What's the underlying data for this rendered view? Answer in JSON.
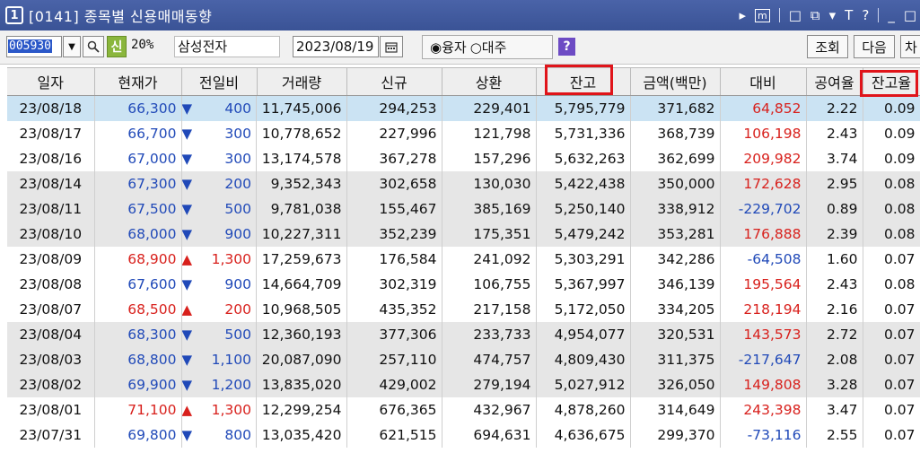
{
  "window": {
    "number": "1",
    "title": "[0141] 종목별 신용매매동향",
    "controls": [
      "▸",
      "m",
      "□",
      "⧉",
      "▾",
      "T",
      "?",
      "_",
      "□"
    ]
  },
  "toolbar": {
    "code": "005930",
    "shin_label": "신",
    "pct_label": "20%",
    "stock_name": "삼성전자",
    "date": "2023/08/19",
    "radio_loan": "◉융자",
    "radio_borrow": "○대주",
    "help_label": "?",
    "inquire_label": "조회",
    "next_label": "다음",
    "chart_label": "차"
  },
  "table": {
    "headers": [
      "일자",
      "현재가",
      "전일비",
      "거래량",
      "신규",
      "상환",
      "잔고",
      "금액(백만)",
      "대비",
      "공여율",
      "잔고율"
    ],
    "rows": [
      {
        "date": "23/08/18",
        "price": "66,300",
        "price_color": "blue",
        "dir": "down",
        "chg": "400",
        "vol": "11,745,006",
        "new": "294,253",
        "repay": "229,401",
        "bal": "5,795,779",
        "amt": "371,682",
        "diff": "64,852",
        "diff_color": "red",
        "rate": "2.22",
        "bal_rate": "0.09",
        "style": "sel"
      },
      {
        "date": "23/08/17",
        "price": "66,700",
        "price_color": "blue",
        "dir": "down",
        "chg": "300",
        "vol": "10,778,652",
        "new": "227,996",
        "repay": "121,798",
        "bal": "5,731,336",
        "amt": "368,739",
        "diff": "106,198",
        "diff_color": "red",
        "rate": "2.43",
        "bal_rate": "0.09",
        "style": "white"
      },
      {
        "date": "23/08/16",
        "price": "67,000",
        "price_color": "blue",
        "dir": "down",
        "chg": "300",
        "vol": "13,174,578",
        "new": "367,278",
        "repay": "157,296",
        "bal": "5,632,263",
        "amt": "362,699",
        "diff": "209,982",
        "diff_color": "red",
        "rate": "3.74",
        "bal_rate": "0.09",
        "style": "white"
      },
      {
        "date": "23/08/14",
        "price": "67,300",
        "price_color": "blue",
        "dir": "down",
        "chg": "200",
        "vol": "9,352,343",
        "new": "302,658",
        "repay": "130,030",
        "bal": "5,422,438",
        "amt": "350,000",
        "diff": "172,628",
        "diff_color": "red",
        "rate": "2.95",
        "bal_rate": "0.08",
        "style": "gray"
      },
      {
        "date": "23/08/11",
        "price": "67,500",
        "price_color": "blue",
        "dir": "down",
        "chg": "500",
        "vol": "9,781,038",
        "new": "155,467",
        "repay": "385,169",
        "bal": "5,250,140",
        "amt": "338,912",
        "diff": "-229,702",
        "diff_color": "blue",
        "rate": "0.89",
        "bal_rate": "0.08",
        "style": "gray"
      },
      {
        "date": "23/08/10",
        "price": "68,000",
        "price_color": "blue",
        "dir": "down",
        "chg": "900",
        "vol": "10,227,311",
        "new": "352,239",
        "repay": "175,351",
        "bal": "5,479,242",
        "amt": "353,281",
        "diff": "176,888",
        "diff_color": "red",
        "rate": "2.39",
        "bal_rate": "0.08",
        "style": "gray"
      },
      {
        "date": "23/08/09",
        "price": "68,900",
        "price_color": "red",
        "dir": "up",
        "chg": "1,300",
        "vol": "17,259,673",
        "new": "176,584",
        "repay": "241,092",
        "bal": "5,303,291",
        "amt": "342,286",
        "diff": "-64,508",
        "diff_color": "blue",
        "rate": "1.60",
        "bal_rate": "0.07",
        "style": "white"
      },
      {
        "date": "23/08/08",
        "price": "67,600",
        "price_color": "blue",
        "dir": "down",
        "chg": "900",
        "vol": "14,664,709",
        "new": "302,319",
        "repay": "106,755",
        "bal": "5,367,997",
        "amt": "346,139",
        "diff": "195,564",
        "diff_color": "red",
        "rate": "2.43",
        "bal_rate": "0.08",
        "style": "white"
      },
      {
        "date": "23/08/07",
        "price": "68,500",
        "price_color": "red",
        "dir": "up",
        "chg": "200",
        "vol": "10,968,505",
        "new": "435,352",
        "repay": "217,158",
        "bal": "5,172,050",
        "amt": "334,205",
        "diff": "218,194",
        "diff_color": "red",
        "rate": "2.16",
        "bal_rate": "0.07",
        "style": "white"
      },
      {
        "date": "23/08/04",
        "price": "68,300",
        "price_color": "blue",
        "dir": "down",
        "chg": "500",
        "vol": "12,360,193",
        "new": "377,306",
        "repay": "233,733",
        "bal": "4,954,077",
        "amt": "320,531",
        "diff": "143,573",
        "diff_color": "red",
        "rate": "2.72",
        "bal_rate": "0.07",
        "style": "gray"
      },
      {
        "date": "23/08/03",
        "price": "68,800",
        "price_color": "blue",
        "dir": "down",
        "chg": "1,100",
        "vol": "20,087,090",
        "new": "257,110",
        "repay": "474,757",
        "bal": "4,809,430",
        "amt": "311,375",
        "diff": "-217,647",
        "diff_color": "blue",
        "rate": "2.08",
        "bal_rate": "0.07",
        "style": "gray"
      },
      {
        "date": "23/08/02",
        "price": "69,900",
        "price_color": "blue",
        "dir": "down",
        "chg": "1,200",
        "vol": "13,835,020",
        "new": "429,002",
        "repay": "279,194",
        "bal": "5,027,912",
        "amt": "326,050",
        "diff": "149,808",
        "diff_color": "red",
        "rate": "3.28",
        "bal_rate": "0.07",
        "style": "gray"
      },
      {
        "date": "23/08/01",
        "price": "71,100",
        "price_color": "red",
        "dir": "up",
        "chg": "1,300",
        "vol": "12,299,254",
        "new": "676,365",
        "repay": "432,967",
        "bal": "4,878,260",
        "amt": "314,649",
        "diff": "243,398",
        "diff_color": "red",
        "rate": "3.47",
        "bal_rate": "0.07",
        "style": "white"
      },
      {
        "date": "23/07/31",
        "price": "69,800",
        "price_color": "blue",
        "dir": "down",
        "chg": "800",
        "vol": "13,035,420",
        "new": "621,515",
        "repay": "694,631",
        "bal": "4,636,675",
        "amt": "299,370",
        "diff": "-73,116",
        "diff_color": "blue",
        "rate": "2.55",
        "bal_rate": "0.07",
        "style": "white"
      }
    ]
  },
  "colors": {
    "titlebar": "#3a5396",
    "selected_row": "#cbe3f3",
    "gray_row": "#e6e6e6",
    "up": "#d8201c",
    "down": "#2049b8",
    "highlight_box": "#e0141a"
  },
  "highlights": [
    "잔고",
    "잔고율"
  ]
}
